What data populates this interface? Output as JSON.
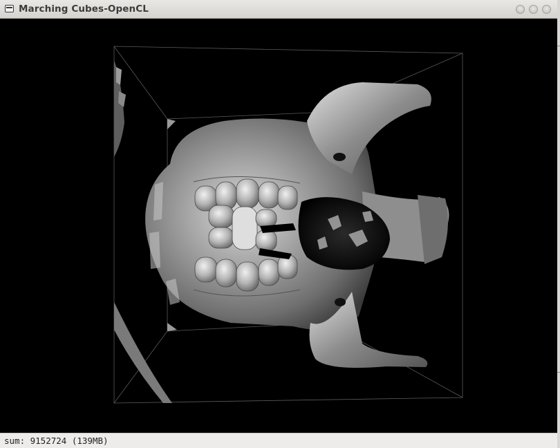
{
  "window": {
    "title": "Marching Cubes-OpenCL"
  },
  "viewport": {
    "background_color": "#000000",
    "bounding_box_color": "#5a5a5a",
    "mesh_color": "#9a9a9a",
    "mesh_description": "rendered isosurface mesh"
  },
  "status": {
    "text": "sum: 9152724 (139MB)"
  }
}
